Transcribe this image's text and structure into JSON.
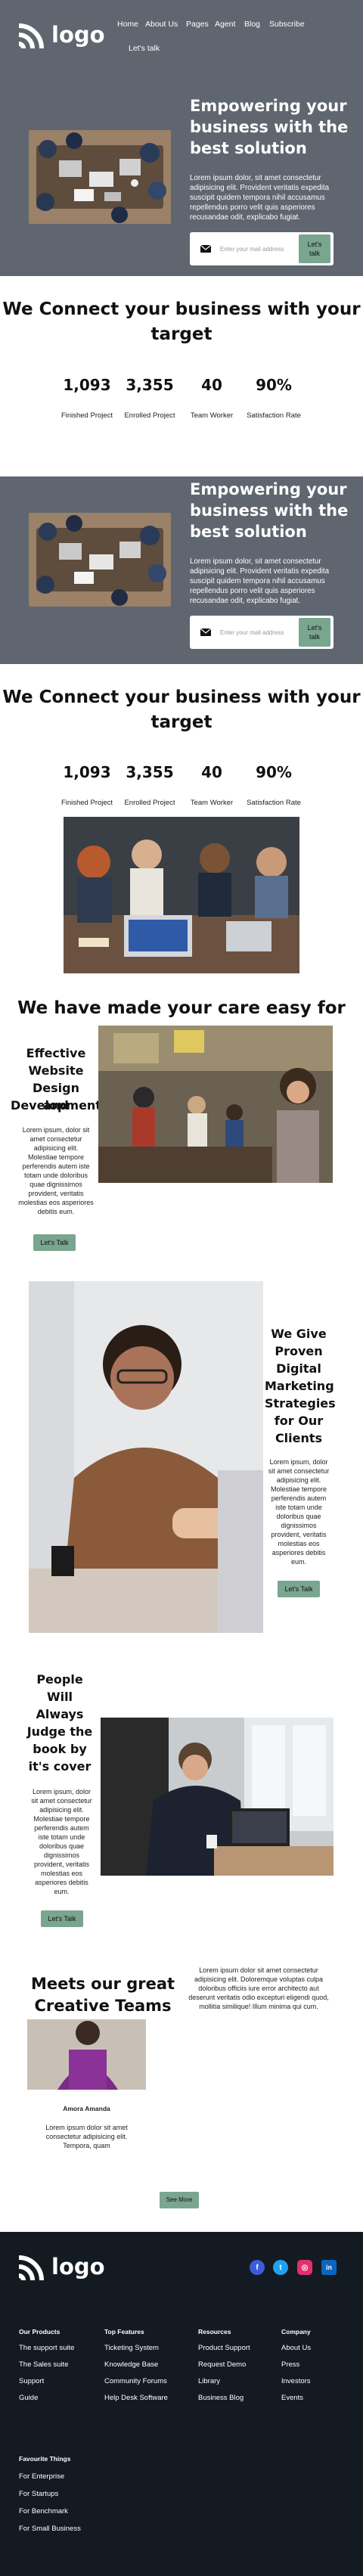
{
  "brand": {
    "name": "logo"
  },
  "nav": {
    "items": [
      "Home",
      "About Us",
      "Pages",
      "Agent",
      "Blog",
      "Subscribe"
    ],
    "cta": "Let's talk"
  },
  "hero": {
    "title_lines": [
      "Empowering your",
      "business with the",
      "best solution"
    ],
    "text_lines": [
      "Lorem ipsum dolor, sit amet consectetur",
      "adipisicing elit. Provident veritatis expedita",
      "suscipit quidem tempora nihil accusamus",
      "repellendus porro velit quis asperiores",
      "recusandae odit, explicabo fugiat."
    ],
    "email_placeholder": "Enter your mail address",
    "button": [
      "Let's",
      "talk"
    ]
  },
  "connect": {
    "title_lines": [
      "We Connect your business with your",
      "target"
    ],
    "stats": [
      {
        "value": "1,093",
        "label": "Finished Project"
      },
      {
        "value": "3,355",
        "label": "Enrolled Project"
      },
      {
        "value": "40",
        "label": "Team Worker"
      },
      {
        "value": "90%",
        "label": "Satisfaction Rate"
      }
    ]
  },
  "care": {
    "title": "We have made your care easy for you."
  },
  "features": [
    {
      "title_lines": [
        "Effective",
        "Website",
        "Design and",
        "Development"
      ],
      "text_lines": [
        "Lorem ipsum, dolor sit",
        "amet consectetur",
        "adipisicing elit.",
        "Molestiae tempore",
        "perferendis autem iste",
        "totam unde doloribus",
        "quae dignissimos",
        "provident, veritatis",
        "molestias eos asperiores",
        "debitis eum."
      ],
      "button": "Let's Talk"
    },
    {
      "title_lines": [
        "We Give",
        "Proven",
        "Digital",
        "Marketing",
        "Strategies",
        "for Our",
        "Clients"
      ],
      "text_lines": [
        "Lorem ipsum, dolor",
        "sit amet consectetur",
        "adipisicing elit.",
        "Molestiae tempore",
        "perferendis autem",
        "iste totam unde",
        "doloribus quae",
        "dignissimos",
        "provident, veritatis",
        "molestias eos",
        "asperiores debitis",
        "eum."
      ],
      "button": "Let's Talk"
    },
    {
      "title_lines": [
        "People",
        "Will",
        "Always",
        "Judge the",
        "book by",
        "it's cover"
      ],
      "text_lines": [
        "Lorem ipsum, dolor",
        "sit amet consectetur",
        "adipisicing elit.",
        "Molestiae tempore",
        "perferendis autem",
        "iste totam unde",
        "doloribus quae",
        "dignissimos",
        "provident, veritatis",
        "molestias eos",
        "asperiores debitis",
        "eum."
      ],
      "button": "Let's Talk"
    }
  ],
  "team": {
    "title_lines": [
      "Meets our great",
      "Creative Teams"
    ],
    "intro_lines": [
      "Lorem ipsum dolor sit amet consectetur",
      "adipisicing elit. Doloremque voluptas culpa",
      "doloribus officiis iure error architecto aut",
      "deserunt veritatis odio excepturi eligendi quod,",
      "mollitia similique! Illum minima qui cum."
    ],
    "member_name": "Amora Amanda",
    "member_text": [
      "Lorem ipsum dolor sit amet",
      "consectetur adipisicing elit.",
      "Tempora, quam"
    ],
    "see_more": "See More"
  },
  "footer": {
    "social": [
      {
        "icon": "facebook-icon",
        "glyph": "f",
        "color": "#3b5bdb"
      },
      {
        "icon": "twitter-icon",
        "glyph": "t",
        "color": "#1da1f2"
      },
      {
        "icon": "instagram-icon",
        "glyph": "◎",
        "color": "#e1306c"
      },
      {
        "icon": "linkedin-icon",
        "glyph": "in",
        "color": "#0a66c2"
      }
    ],
    "columns": [
      {
        "heading": "Our Products",
        "links": [
          "The support suite",
          "The Sales suite",
          "Support",
          "Guide"
        ]
      },
      {
        "heading": "Top Features",
        "links": [
          "Ticketing System",
          "Knowledge Base",
          "Community Forums",
          "Help Desk Software"
        ]
      },
      {
        "heading": "Resources",
        "links": [
          "Product Support",
          "Request Demo",
          "Library",
          "Business Blog"
        ]
      },
      {
        "heading": "Company",
        "links": [
          "About Us",
          "Press",
          "Investors",
          "Events"
        ]
      }
    ],
    "favourite": {
      "heading": "Favourite Things",
      "links": [
        "For Enterprise",
        "For Startups",
        "For Benchmark",
        "For Small Business"
      ]
    }
  },
  "colors": {
    "hero_bg": "#5f6670",
    "accent_green": "#7aa58e",
    "footer_bg": "#141a22"
  }
}
